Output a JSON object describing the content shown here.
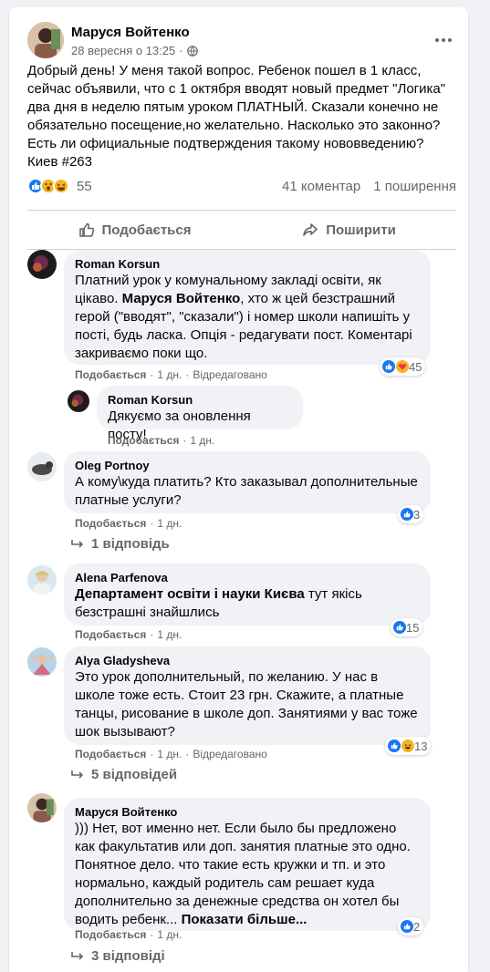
{
  "post": {
    "author": "Маруся Войтенко",
    "date": "28 вересня о 13:25",
    "dot": "·",
    "text": "Добрый день! У меня такой вопрос. Ребенок пошел в 1 класс, сейчас объявили, что с 1 октября вводят новый предмет \"Логика\" два дня в неделю пятым уроком ПЛАТНЫЙ. Сказали конечно не обязательно посещение,но желательно. Насколько это законно? Есть ли официальные подтверждения такому нововведению? Киев #263",
    "reactions_count": "55",
    "comments_count": "41 коментар",
    "shares_count": "1 поширення",
    "reaction_icons": [
      "like-icon",
      "wow-icon",
      "haha-icon"
    ]
  },
  "actions": {
    "like_label": "Подобається",
    "share_label": "Поширити"
  },
  "comments": [
    {
      "name": "Roman Korsun",
      "text_pre": "Платний урок у комунальному закладі освіти, як цікаво. ",
      "mention": "Маруся Войтенко",
      "text_post": ", хто ж цей безстрашний герой (\"вводят\", \"сказали\") і номер школи напишіть у пості, будь ласка. Опція - редагувати пост. Коментарі закриваємо поки що.",
      "like": "Подобається",
      "time": "1 дн.",
      "edited": "Відредаговано",
      "react_count": "45"
    },
    {
      "name": "Roman Korsun",
      "text": "Дякуємо за оновлення посту!",
      "like": "Подобається",
      "time": "1 дн."
    },
    {
      "name": "Oleg Portnoy",
      "text": "А кому\\куда платить? Кто заказывал дополнительные платные услуги?",
      "like": "Подобається",
      "time": "1 дн.",
      "react_count": "3",
      "replies": "1 відповідь"
    },
    {
      "name": "Alena Parfenova",
      "mention": "Департамент освіти і науки Києва",
      "text_post": " тут якісь безстрашні знайшлись",
      "like": "Подобається",
      "time": "1 дн.",
      "react_count": "15"
    },
    {
      "name": "Alya Gladysheva",
      "text": "Это урок дополнительный, по желанию. У нас в школе тоже есть. Стоит 23 грн. Скажите, а платные танцы, рисование в школе доп. Занятиями у вас тоже шок вызывают?",
      "like": "Подобається",
      "time": "1 дн.",
      "edited": "Відредаговано",
      "react_count": "13",
      "replies": "5 відповідей"
    },
    {
      "name": "Маруся Войтенко",
      "text": "))) Нет, вот именно нет. Если было бы предложено как факультатив или доп. занятия платные это одно. Понятное дело. что такие есть кружки и тп. и это нормально, каждый родитель сам решает куда дополнительно за денежные средства он хотел бы водить ребенк...",
      "see_more": "Показати більше...",
      "like": "Подобається",
      "time": "1 дн.",
      "react_count": "2",
      "replies": "3 відповіді"
    }
  ],
  "sep": "·",
  "colors": {
    "accent": "#1877f2",
    "secondary_text": "#65676b",
    "bubble": "#f0f2f5"
  }
}
